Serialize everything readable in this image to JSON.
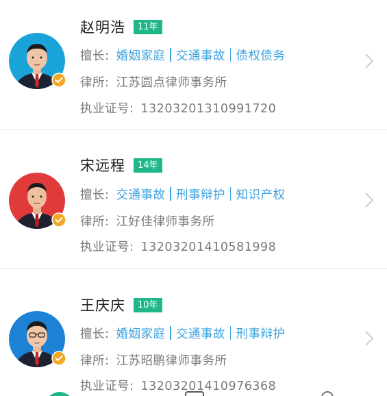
{
  "labels": {
    "specialty_prefix": "擅长:",
    "firm_prefix": "律所:",
    "license_prefix": "执业证号:"
  },
  "colors": {
    "years_badge": "#1fb78a",
    "specialty": "#3ea3e0",
    "verified_badge": "#f5a623"
  },
  "lawyers": [
    {
      "name": "赵明浩",
      "years": "11年",
      "specialties": [
        "婚姻家庭",
        "交通事故",
        "债权债务"
      ],
      "firm": "江苏圆点律师事务所",
      "license": "13203201310991720",
      "avatar_icon": "lawyer-portrait-icon",
      "avatar_bg": "#1aa3d8",
      "verified": true
    },
    {
      "name": "宋远程",
      "years": "14年",
      "specialties": [
        "交通事故",
        "刑事辩护",
        "知识产权"
      ],
      "firm": "江好佳律师事务所",
      "license": "13203201410581998",
      "avatar_icon": "lawyer-portrait-icon",
      "avatar_bg": "#e03a3a",
      "verified": true
    },
    {
      "name": "王庆庆",
      "years": "10年",
      "specialties": [
        "婚姻家庭",
        "交通事故",
        "刑事辩护"
      ],
      "firm": "江苏昭鹏律师事务所",
      "license": "13203201410976368",
      "avatar_icon": "lawyer-portrait-icon",
      "avatar_bg": "#1d82d6",
      "verified": true
    }
  ]
}
